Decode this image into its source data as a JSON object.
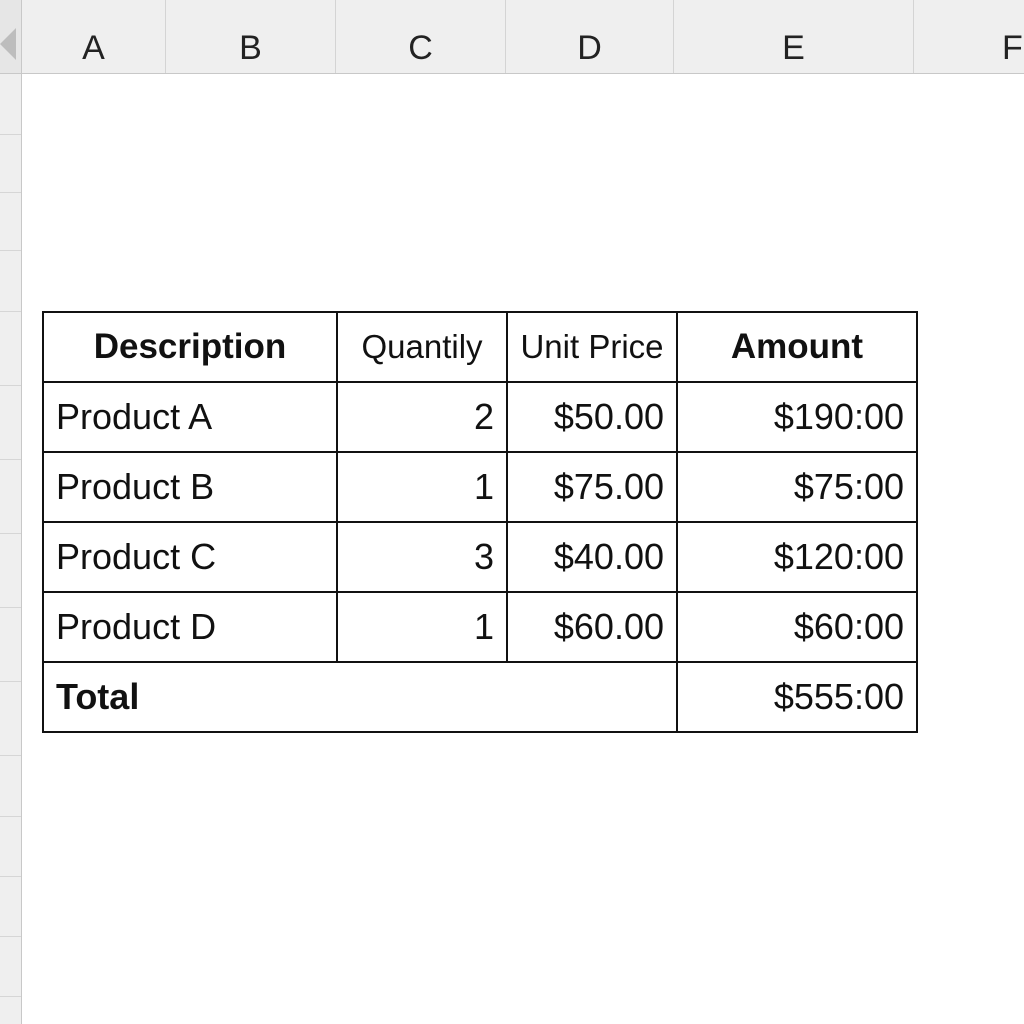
{
  "columns": [
    "A",
    "B",
    "C",
    "D",
    "E",
    "F"
  ],
  "table": {
    "headers": {
      "description": "Description",
      "quantity": "Quantily",
      "unit_price": "Unit Price",
      "amount": "Amount"
    },
    "rows": [
      {
        "description": "Product A",
        "quantity": "2",
        "unit_price": "$50.00",
        "amount": "$190:00"
      },
      {
        "description": "Product B",
        "quantity": "1",
        "unit_price": "$75.00",
        "amount": "$75:00"
      },
      {
        "description": "Product C",
        "quantity": "3",
        "unit_price": "$40.00",
        "amount": "$120:00"
      },
      {
        "description": "Product D",
        "quantity": "1",
        "unit_price": "$60.00",
        "amount": "$60:00"
      }
    ],
    "total": {
      "label": "Total",
      "amount": "$555:00"
    }
  },
  "icons": {
    "select_all": "select-all-triangle-icon"
  }
}
